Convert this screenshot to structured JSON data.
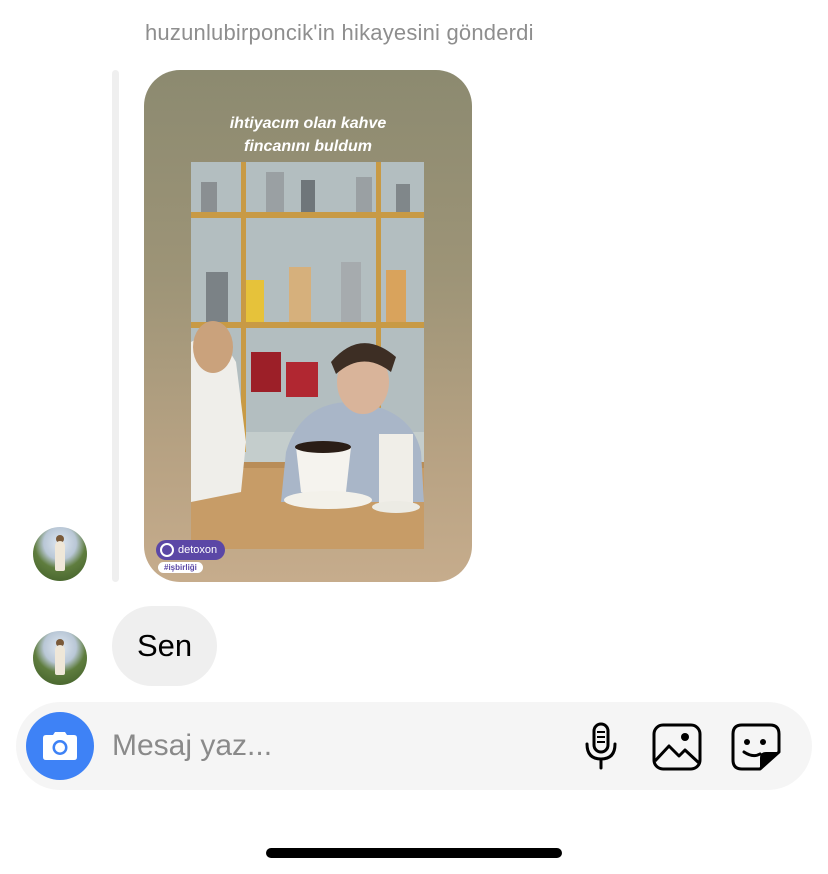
{
  "story": {
    "header_text": "huzunlubirponcik'in hikayesini gönderdi",
    "caption": "ihtiyacım olan kahve\nfincanını buldum",
    "brand_name": "detoxon",
    "brand_tag": "#işbirliği"
  },
  "message": {
    "text": "Sen"
  },
  "composer": {
    "placeholder": "Mesaj yaz..."
  },
  "icons": {
    "camera": "camera-icon",
    "microphone": "microphone-icon",
    "gallery": "gallery-icon",
    "sticker": "sticker-icon"
  },
  "colors": {
    "camera_button": "#3e82f6",
    "bubble_background": "#efefef",
    "composer_background": "#f5f5f5",
    "header_text": "#8e8e8e",
    "brand": "#5b47a6"
  }
}
